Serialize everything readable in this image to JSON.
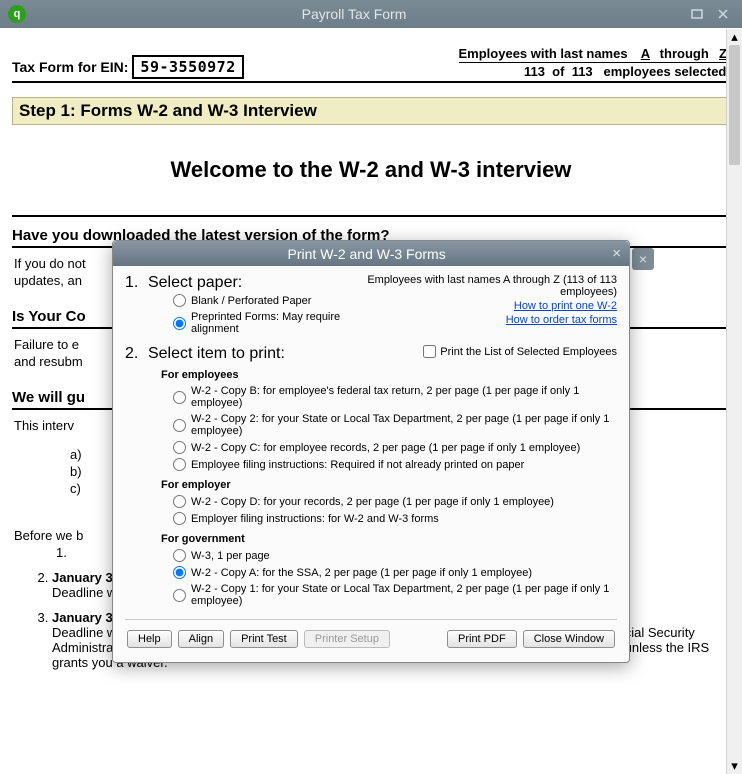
{
  "window": {
    "title": "Payroll Tax Form"
  },
  "header": {
    "ein_label": "Tax Form for EIN:",
    "ein_value": "59-3550972",
    "emp_label": "Employees with last names",
    "from_letter": "A",
    "through": "through",
    "to_letter": "Z",
    "count_a": "113",
    "of": "of",
    "count_b": "113",
    "sel_label": "employees selected"
  },
  "step": {
    "label": "Step 1:   Forms W-2 and W-3 Interview"
  },
  "welcome": "Welcome to the W-2 and W-3 interview",
  "q1": "Have you downloaded the latest version of the form?",
  "q1_body_a": "If you do not",
  "q1_body_b": "updates, an",
  "q2": "Is Your Co",
  "q2_body": "Failure to e\nand resubm",
  "guide_h": "We will gu",
  "guide_p": "This interv",
  "letters": {
    "a": "a)",
    "b": "b)",
    "c": "c)"
  },
  "before": "Before we b",
  "dl": {
    "n1": "1.",
    "n2_date": "January 31, 2020",
    "n2_body": "Deadline when employers must file copies of the W-2s with government agencies.",
    "n3_num": "3.",
    "n3_date": "January 31, 2020",
    "n3_body": "Deadline when employers who file electronically must file federal copies of the W-2s with the Social Security Administration (SSA). Employers filing 250 or more W-2 forms must file electronically with the SSA, unless the IRS grants you a waiver."
  },
  "modal": {
    "title": "Print W-2 and W-3 Forms",
    "s1_num": "1.",
    "s1": "Select paper:",
    "paper_blank": "Blank / Perforated Paper",
    "paper_pre": "Preprinted Forms: May require alignment",
    "info_emp": "Employees with last names A through Z (113 of 113 employees)",
    "link1": "How to print one W-2",
    "link2": "How to order tax forms",
    "s2_num": "2.",
    "s2": "Select item to print:",
    "chk": "Print the List of Selected Employees",
    "h_emp": "For employees",
    "opt_b": "W-2 - Copy B: for employee's federal tax return, 2 per page (1 per page if only 1 employee)",
    "opt_2": "W-2 - Copy 2: for your State or Local Tax Department, 2 per page (1 per page if only 1 employee)",
    "opt_c": "W-2 - Copy C: for employee records, 2 per page (1 per page if only 1 employee)",
    "opt_inst": "Employee filing instructions: Required if not already printed on paper",
    "h_empr": "For employer",
    "opt_d": "W-2 - Copy D: for your records, 2 per page (1 per page if only 1 employee)",
    "opt_empr_inst": "Employer filing instructions: for W-2 and W-3 forms",
    "h_gov": "For government",
    "opt_w3": "W-3, 1 per page",
    "opt_a": "W-2 - Copy A: for the SSA, 2 per page (1 per page if only 1 employee)",
    "opt_1": "W-2 - Copy 1: for your State or Local Tax Department, 2 per page (1 per page if only 1 employee)",
    "btn_help": "Help",
    "btn_align": "Align",
    "btn_test": "Print Test",
    "btn_setup": "Printer Setup",
    "btn_pdf": "Print PDF",
    "btn_close": "Close Window"
  }
}
